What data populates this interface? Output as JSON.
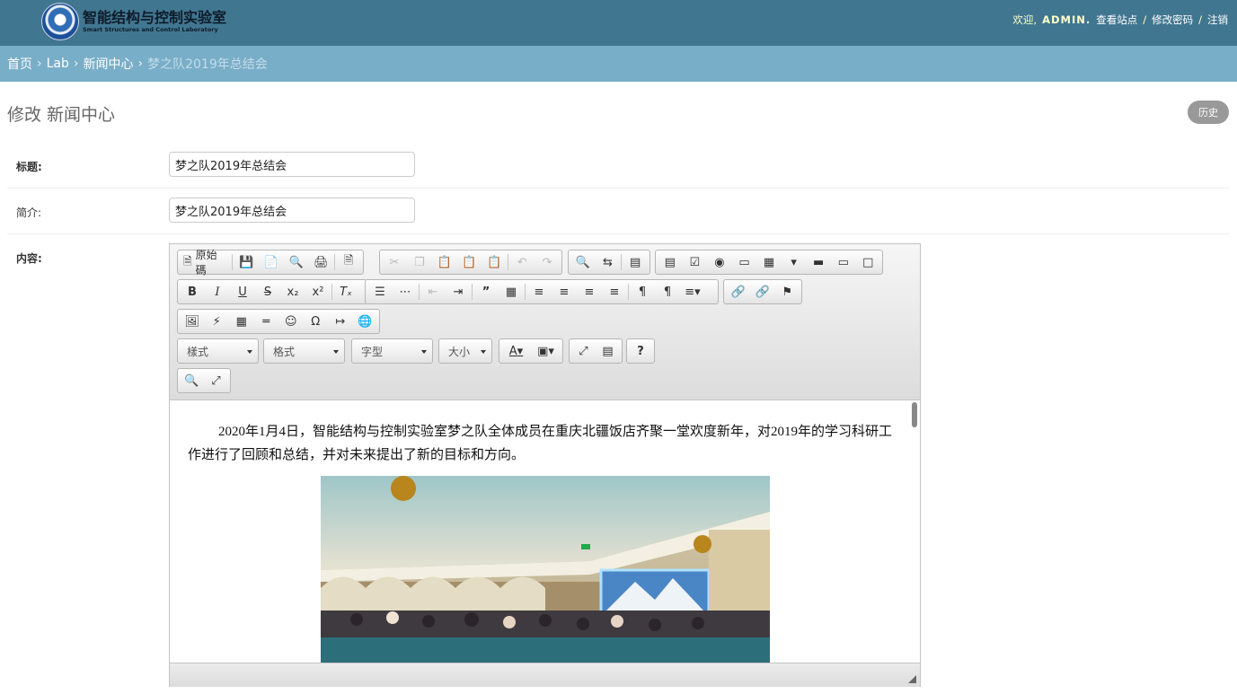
{
  "header": {
    "brand_cn": "智能结构与控制实验室",
    "brand_en": "Smart Structures and Control Laboratory",
    "welcome": "欢迎,",
    "username": "ADMIN.",
    "view_site": "查看站点",
    "change_password": "修改密码",
    "logout": "注销",
    "divider": "/"
  },
  "breadcrumbs": {
    "home": "首页",
    "app": "Lab",
    "model": "新闻中心",
    "current": "梦之队2019年总结会",
    "separator": "›"
  },
  "page": {
    "title": "修改 新闻中心",
    "history_button": "历史"
  },
  "form": {
    "title_label": "标题:",
    "title_value": "梦之队2019年总结会",
    "intro_label": "简介:",
    "intro_value": "梦之队2019年总结会",
    "content_label": "内容:"
  },
  "editor": {
    "source_label": "原始碼",
    "style_combo": "樣式",
    "format_combo": "格式",
    "font_combo": "字型",
    "size_combo": "大小",
    "content_text": "2020年1月4日，智能结构与控制实验室梦之队全体成员在重庆北疆饭店齐聚一堂欢度新年，对2019年的学习科研工作进行了回顾和总结，并对未来提出了新的目标和方向。"
  },
  "colors": {
    "header_bg": "#417690",
    "breadcrumb_bg": "#79aec8",
    "user_name": "#ffffcc",
    "history_button_bg": "#999999"
  }
}
